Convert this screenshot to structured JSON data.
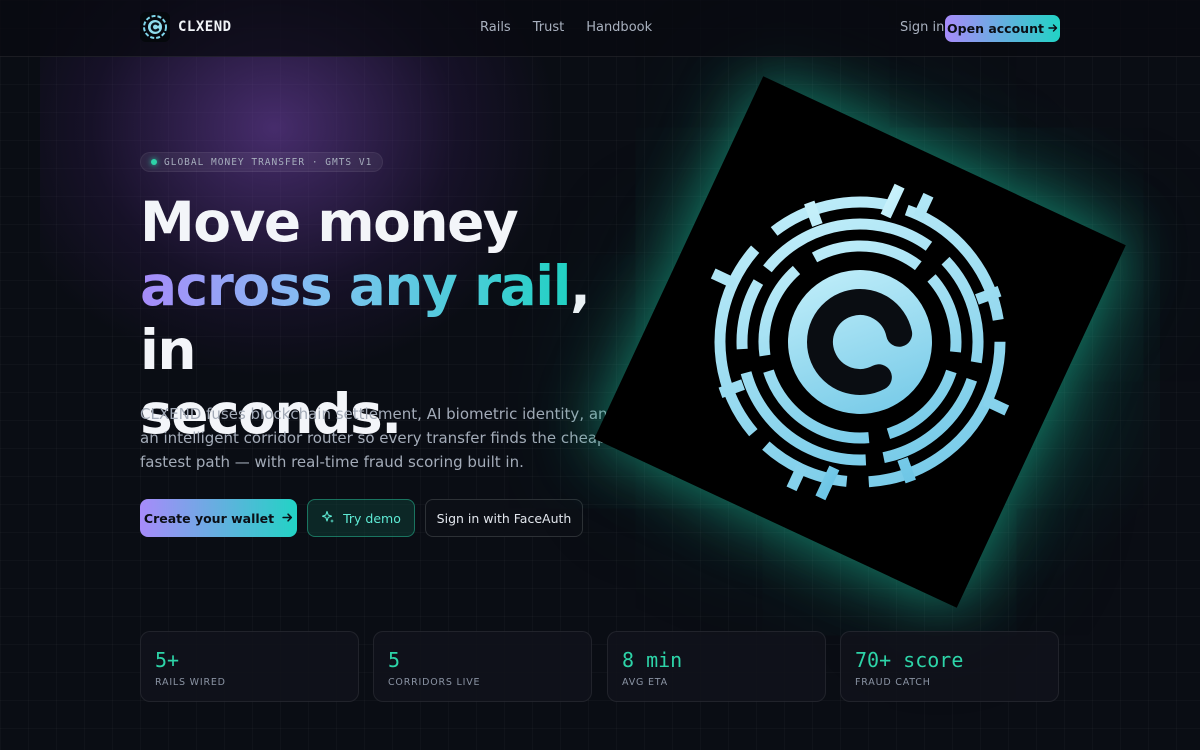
{
  "nav": {
    "brand": "CLXEND",
    "links": [
      "Rails",
      "Trust",
      "Handbook"
    ],
    "sign_in": "Sign in",
    "open_account": "Open account"
  },
  "hero": {
    "pill": "GLOBAL MONEY TRANSFER · GMTS V1",
    "headline_line1": "Move money",
    "headline_highlight": "across any rail",
    "headline_after": ", in",
    "headline_line3": "seconds.",
    "description": "CLXEND fuses blockchain settlement, AI biometric identity, and an intelligent corridor router so every transfer finds the cheapest, fastest path — with real-time fraud scoring built in.",
    "buttons": {
      "create_wallet": "Create your wallet",
      "try_demo": "Try demo",
      "face_auth": "Sign in with FaceAuth"
    }
  },
  "stats": [
    {
      "value": "5+",
      "label": "RAILS WIRED"
    },
    {
      "value": "5",
      "label": "CORRIDORS LIVE"
    },
    {
      "value": "8 min",
      "label": "AVG ETA"
    },
    {
      "value": "70+ score",
      "label": "FRAUD CATCH"
    }
  ],
  "colors": {
    "accent_purple": "#a78bfa",
    "accent_teal": "#22d3c5",
    "stat_value": "#2dd4a8",
    "background": "#0a0d14"
  },
  "icons": {
    "brand": "clxend-logo-icon",
    "arrow": "arrow-right-icon",
    "demo": "sparkle-icon",
    "hero_art": "clxend-maze-emblem"
  }
}
